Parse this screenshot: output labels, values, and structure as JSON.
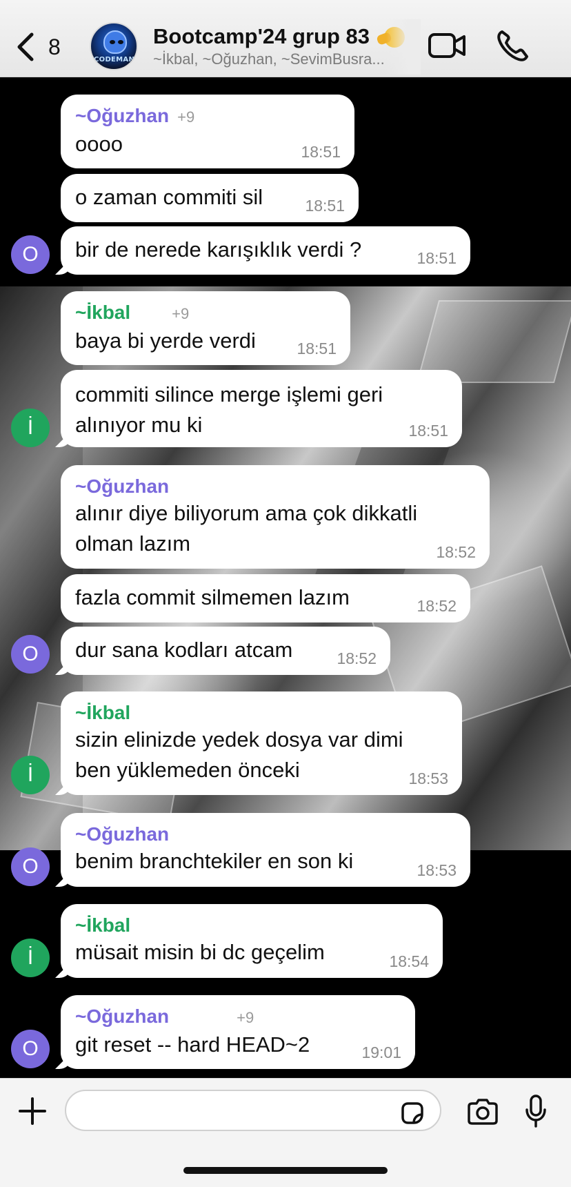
{
  "header": {
    "back_count": "8",
    "group_logo_text": "CODEMANIA",
    "title": "Bootcamp'24 grup 83",
    "members": "~İkbal, ~Oğuzhan, ~SevimBusra..."
  },
  "messages": [
    {
      "sender": "~Oğuzhan",
      "phone": "+9",
      "text": "oooo",
      "time": "18:51"
    },
    {
      "text": "o zaman commiti sil",
      "time": "18:51"
    },
    {
      "text": "bir de nerede karışıklık verdi ?",
      "time": "18:51"
    },
    {
      "sender": "~İkbal",
      "phone": "+9",
      "text": "baya bi yerde verdi",
      "time": "18:51"
    },
    {
      "text": "commiti silince merge işlemi geri\nalınıyor mu ki",
      "time": "18:51"
    },
    {
      "sender": "~Oğuzhan",
      "text": "alınır diye biliyorum ama çok dikkatli\nolman lazım",
      "time": "18:52"
    },
    {
      "text": "fazla commit silmemen lazım",
      "time": "18:52"
    },
    {
      "text": "dur sana kodları atcam",
      "time": "18:52"
    },
    {
      "sender": "~İkbal",
      "text": "sizin elinizde yedek dosya var dimi\nben yüklemeden önceki",
      "time": "18:53"
    },
    {
      "sender": "~Oğuzhan",
      "text": "benim branchtekiler en son ki",
      "time": "18:53"
    },
    {
      "sender": "~İkbal",
      "text": "müsait misin bi dc geçelim",
      "time": "18:54"
    },
    {
      "sender": "~Oğuzhan",
      "phone": "+9",
      "text": "git reset -- hard HEAD~2",
      "time": "19:01"
    }
  ],
  "avatars": {
    "oguzhan": "O",
    "ikbal": "İ"
  },
  "colors": {
    "oguzhan": "#7a69dc",
    "ikbal": "#20a55d",
    "accent_link": "#111111"
  },
  "icons": [
    "back-chevron-icon",
    "video-call-icon",
    "phone-call-icon",
    "plus-icon",
    "sticker-icon",
    "camera-icon",
    "microphone-icon"
  ]
}
